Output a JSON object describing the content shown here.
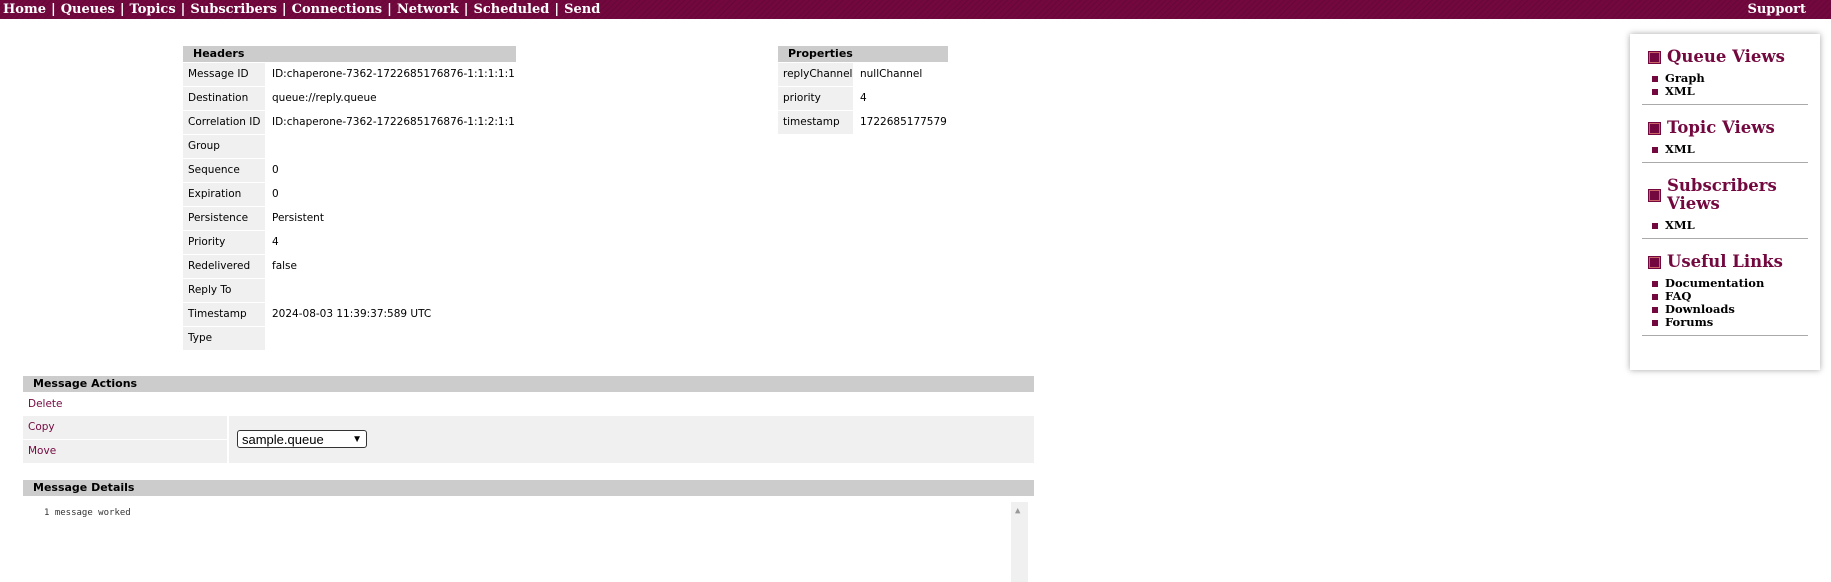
{
  "nav": {
    "items": [
      "Home",
      "Queues",
      "Topics",
      "Subscribers",
      "Connections",
      "Network",
      "Scheduled",
      "Send"
    ],
    "support": "Support"
  },
  "headers": {
    "title": "Headers",
    "rows": [
      {
        "key": "Message ID",
        "value": "ID:chaperone-7362-1722685176876-1:1:1:1:1"
      },
      {
        "key": "Destination",
        "value": "queue://reply.queue"
      },
      {
        "key": "Correlation ID",
        "value": "ID:chaperone-7362-1722685176876-1:1:2:1:1"
      },
      {
        "key": "Group",
        "value": ""
      },
      {
        "key": "Sequence",
        "value": "0"
      },
      {
        "key": "Expiration",
        "value": "0"
      },
      {
        "key": "Persistence",
        "value": "Persistent"
      },
      {
        "key": "Priority",
        "value": "4"
      },
      {
        "key": "Redelivered",
        "value": "false"
      },
      {
        "key": "Reply To",
        "value": ""
      },
      {
        "key": "Timestamp",
        "value": "2024-08-03 11:39:37:589 UTC"
      },
      {
        "key": "Type",
        "value": ""
      }
    ]
  },
  "properties": {
    "title": "Properties",
    "rows": [
      {
        "key": "replyChannel",
        "value": "nullChannel"
      },
      {
        "key": "priority",
        "value": "4"
      },
      {
        "key": "timestamp",
        "value": "1722685177579"
      }
    ]
  },
  "actions": {
    "title": "Message Actions",
    "delete": "Delete",
    "copy": "Copy",
    "move": "Move",
    "selected_queue": "sample.queue"
  },
  "details": {
    "title": "Message Details",
    "body": "1 message worked"
  },
  "sidebar": {
    "sections": [
      {
        "title": "Queue Views",
        "links": [
          "Graph",
          "XML"
        ]
      },
      {
        "title": "Topic Views",
        "links": [
          "XML"
        ]
      },
      {
        "title": "Subscribers Views",
        "links": [
          "XML"
        ]
      },
      {
        "title": "Useful Links",
        "links": [
          "Documentation",
          "FAQ",
          "Downloads",
          "Forums"
        ]
      }
    ]
  },
  "colors": {
    "brand": "#73083f",
    "header_bg": "#cccccc",
    "cell_bg": "#f0f0f0"
  }
}
